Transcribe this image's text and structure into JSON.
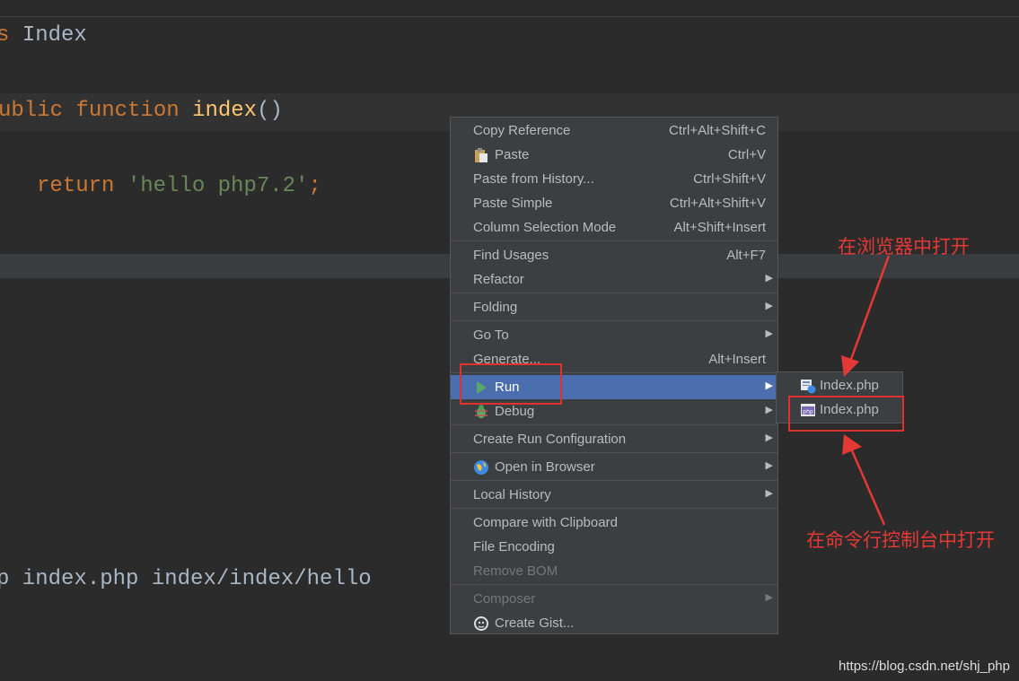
{
  "editor": {
    "line1": {
      "prefix": "s",
      "name": "Index"
    },
    "line2": {
      "kw1": "ublic",
      "kw2": "function",
      "fn": "index",
      "parens": "()"
    },
    "line3": {
      "kw": "return",
      "str": "'hello php7.2'",
      "semi": ";"
    },
    "line4": {
      "text": "p index.php index/index/hello"
    }
  },
  "context_menu": {
    "items": [
      {
        "label": "Copy Reference",
        "shortcut": "Ctrl+Alt+Shift+C"
      },
      {
        "label": "Paste",
        "shortcut": "Ctrl+V",
        "icon": "clipboard-icon"
      },
      {
        "label": "Paste from History...",
        "shortcut": "Ctrl+Shift+V"
      },
      {
        "label": "Paste Simple",
        "shortcut": "Ctrl+Alt+Shift+V"
      },
      {
        "label": "Column Selection Mode",
        "shortcut": "Alt+Shift+Insert"
      },
      {
        "label": "Find Usages",
        "shortcut": "Alt+F7"
      },
      {
        "label": "Refactor",
        "submenu": true
      },
      {
        "label": "Folding",
        "submenu": true
      },
      {
        "label": "Go To",
        "submenu": true
      },
      {
        "label": "Generate...",
        "shortcut": "Alt+Insert"
      },
      {
        "label": "Run",
        "submenu": true,
        "selected": true,
        "icon": "run-icon"
      },
      {
        "label": "Debug",
        "submenu": true,
        "icon": "debug-icon"
      },
      {
        "label": "Create Run Configuration",
        "submenu": true
      },
      {
        "label": "Open in Browser",
        "submenu": true,
        "icon": "browser-icon"
      },
      {
        "label": "Local History",
        "submenu": true
      },
      {
        "label": "Compare with Clipboard"
      },
      {
        "label": "File Encoding"
      },
      {
        "label": "Remove BOM",
        "disabled": true
      },
      {
        "label": "Composer",
        "submenu": true,
        "disabled": true
      },
      {
        "label": "Create Gist...",
        "icon": "github-icon"
      }
    ]
  },
  "run_submenu": {
    "items": [
      {
        "label": "Index.php",
        "icon": "php-web-icon"
      },
      {
        "label": "Index.php",
        "icon": "php-script-icon"
      }
    ]
  },
  "annotations": {
    "browser": "在浏览器中打开",
    "console": "在命令行控制台中打开"
  },
  "watermark": "https://blog.csdn.net/shj_php",
  "colors": {
    "background": "#2b2b2b",
    "menu_bg": "#3c3f41",
    "selection": "#4b6eaf",
    "keyword": "#cc7832",
    "function": "#ffc66d",
    "string": "#6a8759",
    "annotation_red": "#e53935"
  }
}
